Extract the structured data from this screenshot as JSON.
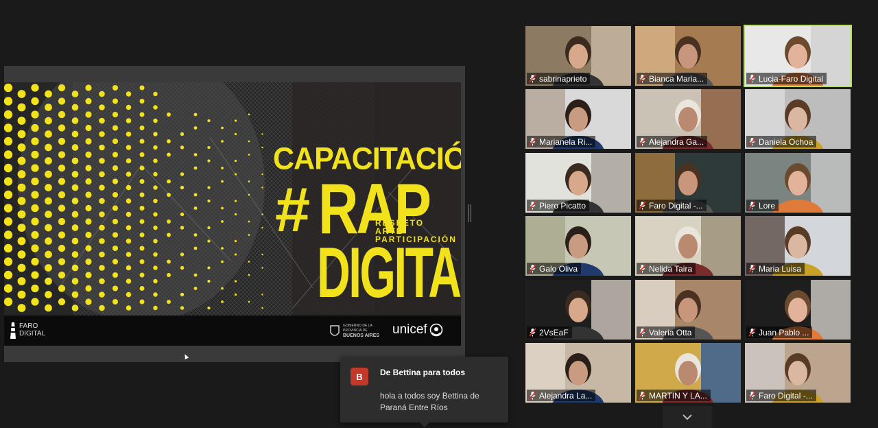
{
  "slide": {
    "title": "CAPACITACIÓN",
    "hash": "#",
    "rap": "RAP",
    "tag_1": "RESPETO",
    "tag_2": "ARTE",
    "tag_3": "PARTICIPACIÓN",
    "digital": "DIGITAL",
    "faro_line1": "FARO",
    "faro_line2": "DIGITAL",
    "ba_line1": "GOBIERNO DE LA PROVINCIA DE",
    "ba_line2": "BUENOS AIRES",
    "unicef": "unicef"
  },
  "participants": [
    {
      "name": "sabrinaprieto",
      "active": false
    },
    {
      "name": "Bianca Maria...",
      "active": false
    },
    {
      "name": "Lucia-Faro Digital",
      "active": true
    },
    {
      "name": "Marianela Ri...",
      "active": false
    },
    {
      "name": "Alejandra Ga...",
      "active": false
    },
    {
      "name": "Daniela Ochoa",
      "active": false
    },
    {
      "name": "Piero Picatto",
      "active": false
    },
    {
      "name": "Faro Digital -...",
      "active": false
    },
    {
      "name": "Lore",
      "active": false
    },
    {
      "name": "Galo Oliva",
      "active": false
    },
    {
      "name": "Nelida Taira",
      "active": false
    },
    {
      "name": "Maria Luisa",
      "active": false
    },
    {
      "name": "2VsEaF",
      "active": false
    },
    {
      "name": "Valeria Otta",
      "active": false
    },
    {
      "name": "Juan Pablo ...",
      "active": false
    },
    {
      "name": "Alejandra La...",
      "active": false
    },
    {
      "name": "MARTIN Y LA...",
      "active": false
    },
    {
      "name": "Faro Digital -...",
      "active": false
    }
  ],
  "chat": {
    "avatar_letter": "B",
    "from": "De Bettina para todos",
    "message": "hola a todos soy Bettina de Paraná Entre Ríos"
  },
  "icons": {
    "muted_mic": "muted-mic-icon",
    "scroll_down": "chevron-down-icon"
  },
  "colors": {
    "accent_yellow": "#f1e21c",
    "active_speaker": "#b8e05a",
    "mute_red": "#e0332b",
    "chat_avatar": "#c0392b"
  }
}
